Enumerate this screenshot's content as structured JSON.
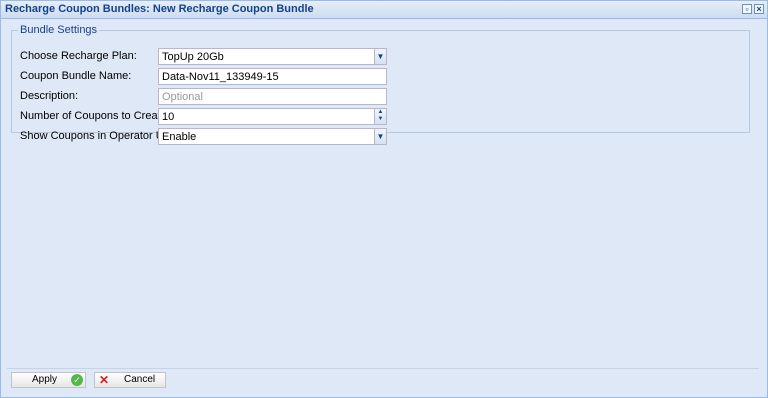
{
  "window": {
    "title": "Recharge Coupon Bundles: New Recharge Coupon Bundle",
    "restore_icon": "restore-icon",
    "close_icon": "close-icon"
  },
  "form": {
    "legend": "Bundle Settings",
    "recharge_plan": {
      "label": "Choose Recharge Plan:",
      "value": "TopUp 20Gb"
    },
    "bundle_name": {
      "label": "Coupon Bundle Name:",
      "value": "Data-Nov11_133949-15"
    },
    "description": {
      "label": "Description:",
      "value": "",
      "placeholder": "Optional"
    },
    "coupons_count": {
      "label": "Number of Coupons to Create:",
      "value": "10"
    },
    "show_in_operator_ui": {
      "label": "Show Coupons in Operator UI:",
      "value": "Enable"
    }
  },
  "footer": {
    "apply_label": "Apply",
    "cancel_label": "Cancel"
  },
  "colors": {
    "title_text": "#15428b",
    "panel_bg": "#dfe8f6",
    "border": "#99bbe8"
  }
}
